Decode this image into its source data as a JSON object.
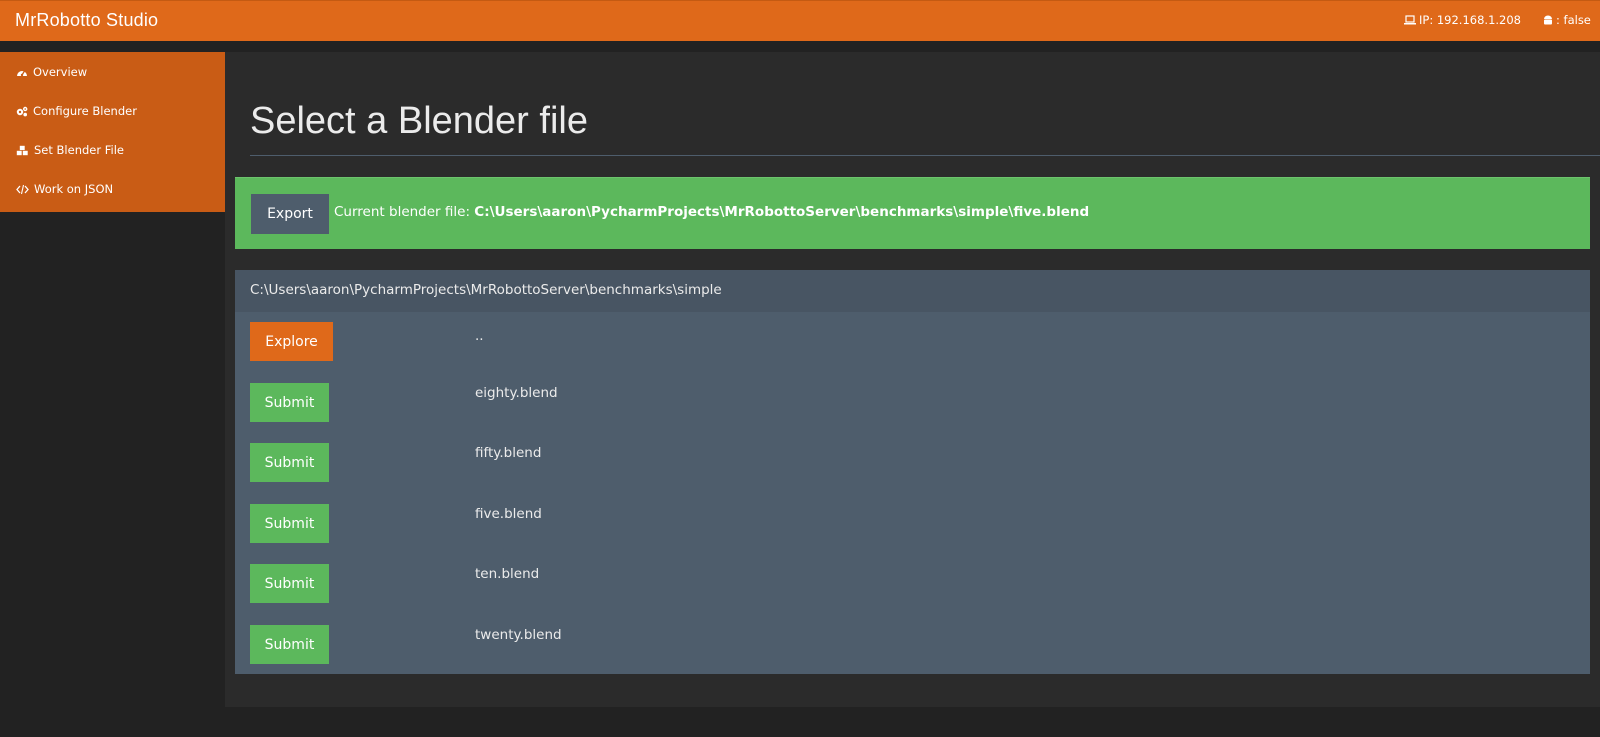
{
  "app": {
    "title": "MrRobotto Studio"
  },
  "header": {
    "ip_label": "IP: 192.168.1.208",
    "android_label": ": false"
  },
  "sidebar": {
    "items": [
      {
        "label": "Overview",
        "icon": "dashboard-icon"
      },
      {
        "label": "Configure Blender",
        "icon": "cogs-icon"
      },
      {
        "label": "Set Blender File",
        "icon": "cubes-icon"
      },
      {
        "label": "Work on JSON",
        "icon": "code-icon"
      }
    ]
  },
  "main": {
    "page_title": "Select a Blender file",
    "alert": {
      "export_label": "Export",
      "current_prefix": "Current blender file: ",
      "current_path": "C:\\Users\\aaron\\PycharmProjects\\MrRobottoServer\\benchmarks\\simple\\five.blend"
    },
    "browser": {
      "path": "C:\\Users\\aaron\\PycharmProjects\\MrRobottoServer\\benchmarks\\simple",
      "rows": [
        {
          "button": "Explore",
          "name": ".."
        },
        {
          "button": "Submit",
          "name": "eighty.blend"
        },
        {
          "button": "Submit",
          "name": "fifty.blend"
        },
        {
          "button": "Submit",
          "name": "five.blend"
        },
        {
          "button": "Submit",
          "name": "ten.blend"
        },
        {
          "button": "Submit",
          "name": "twenty.blend"
        }
      ]
    }
  },
  "colors": {
    "brand_orange": "#df691a",
    "success_green": "#5cb85c",
    "panel_slate": "#4e5d6c",
    "background": "#222222"
  }
}
